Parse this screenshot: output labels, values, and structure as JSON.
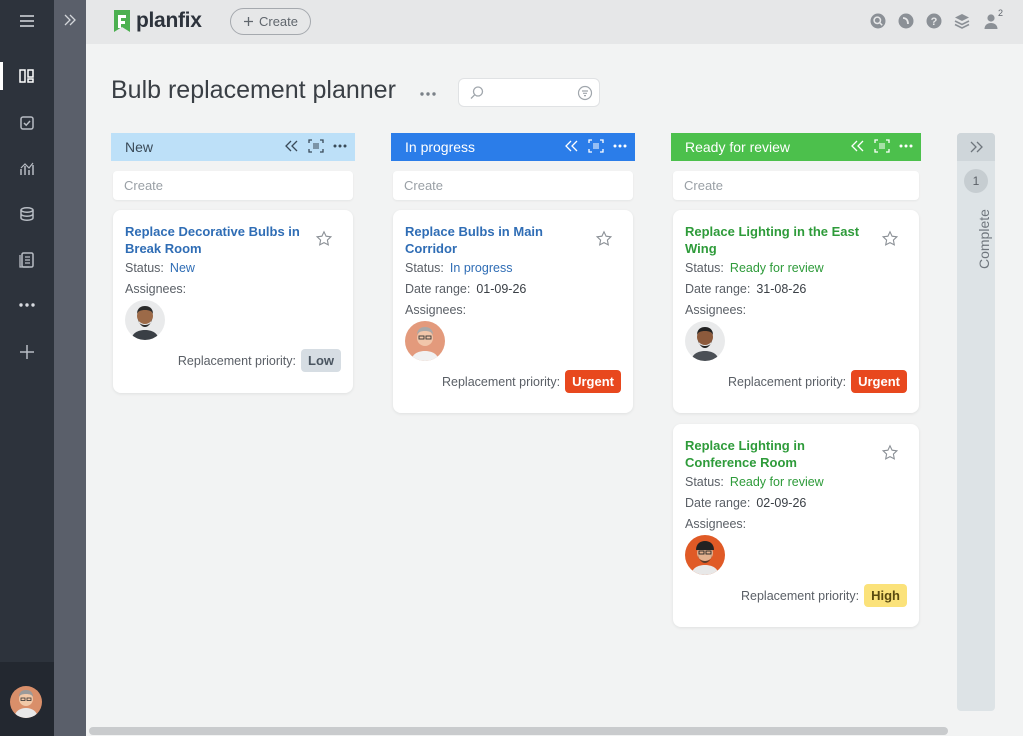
{
  "app": {
    "brand": "planfix",
    "create_label": "Create",
    "notifications_count": "2"
  },
  "sidebar": {
    "items": [
      {
        "icon": "menu-icon"
      },
      {
        "icon": "board-icon",
        "active": true
      },
      {
        "icon": "tasks-icon"
      },
      {
        "icon": "analytics-icon"
      },
      {
        "icon": "database-icon"
      },
      {
        "icon": "documents-icon"
      },
      {
        "icon": "more-icon"
      },
      {
        "icon": "add-icon"
      }
    ]
  },
  "page": {
    "title": "Bulb replacement planner",
    "search_placeholder": ""
  },
  "labels": {
    "status": "Status:",
    "date_range": "Date range:",
    "assignees": "Assignees:",
    "priority": "Replacement priority:",
    "create": "Create"
  },
  "columns": [
    {
      "name": "New",
      "header_bg": "#bde0f8",
      "header_fg": "#3a4a58",
      "cards": [
        {
          "title": "Replace Decorative Bulbs in Break Room",
          "title_color": "#2f6db5",
          "status": "New",
          "status_color": "#2f6db5",
          "date_range": null,
          "priority": "Low",
          "priority_bg": "#d6dde3",
          "priority_fg": "#4a5560"
        }
      ]
    },
    {
      "name": "In progress",
      "header_bg": "#2b7de9",
      "header_fg": "#ffffff",
      "cards": [
        {
          "title": "Replace Bulbs in Main Corridor",
          "title_color": "#2f6db5",
          "status": "In progress",
          "status_color": "#2f6db5",
          "date_range": "01-09-26",
          "priority": "Urgent",
          "priority_bg": "#e8481e",
          "priority_fg": "#ffffff"
        }
      ]
    },
    {
      "name": "Ready for review",
      "header_bg": "#4cc04c",
      "header_fg": "#ffffff",
      "cards": [
        {
          "title": "Replace Lighting in the East Wing",
          "title_color": "#2e9b3a",
          "status": "Ready for review",
          "status_color": "#2e9b3a",
          "date_range": "31-08-26",
          "priority": "Urgent",
          "priority_bg": "#e8481e",
          "priority_fg": "#ffffff"
        },
        {
          "title": "Replace Lighting in Conference Room",
          "title_color": "#2e9b3a",
          "status": "Ready for review",
          "status_color": "#2e9b3a",
          "date_range": "02-09-26",
          "priority": "High",
          "priority_bg": "#fbe27a",
          "priority_fg": "#5a4a10"
        }
      ]
    }
  ],
  "collapsed_column": {
    "name": "Complete",
    "count": "1"
  }
}
